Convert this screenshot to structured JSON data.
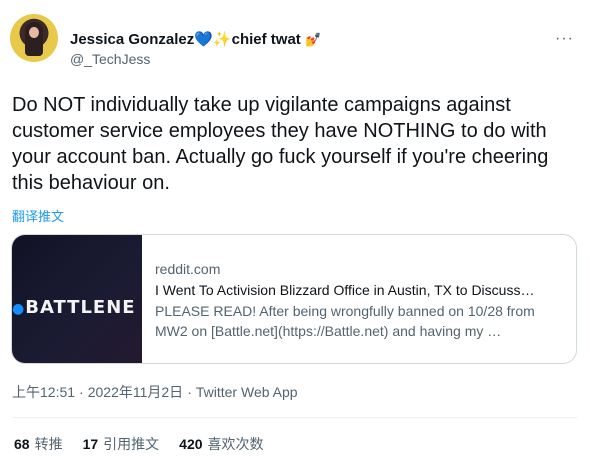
{
  "author": {
    "display_name": "Jessica Gonzalez",
    "name_emoji_1": "💙",
    "name_emoji_2": "✨",
    "name_suffix": "chief twat",
    "name_emoji_3": "💅",
    "handle": "@_TechJess",
    "more_icon": "···"
  },
  "tweet": {
    "text": "Do NOT individually take up vigilante campaigns against customer service employees they have NOTHING to do with your account ban. Actually go fuck yourself if you're cheering this behaviour on.",
    "translate_label": "翻译推文"
  },
  "card": {
    "image_text": "BATTLENE",
    "domain": "reddit.com",
    "title": "I Went To Activision Blizzard Office in Austin, TX to Discuss…",
    "description": "PLEASE READ! After being wrongfully banned on 10/28 from MW2 on [Battle.net](https://Battle.net) and having my …"
  },
  "meta": {
    "time": "上午12:51",
    "date": "2022年11月2日",
    "source": "Twitter Web App",
    "separator": "·"
  },
  "stats": {
    "retweets_count": "68",
    "retweets_label": "转推",
    "quotes_count": "17",
    "quotes_label": "引用推文",
    "likes_count": "420",
    "likes_label": "喜欢次数"
  },
  "colors": {
    "accent": "#1d9bf0",
    "text_primary": "#0f1419",
    "text_secondary": "#536471",
    "border": "#cfd9de"
  }
}
